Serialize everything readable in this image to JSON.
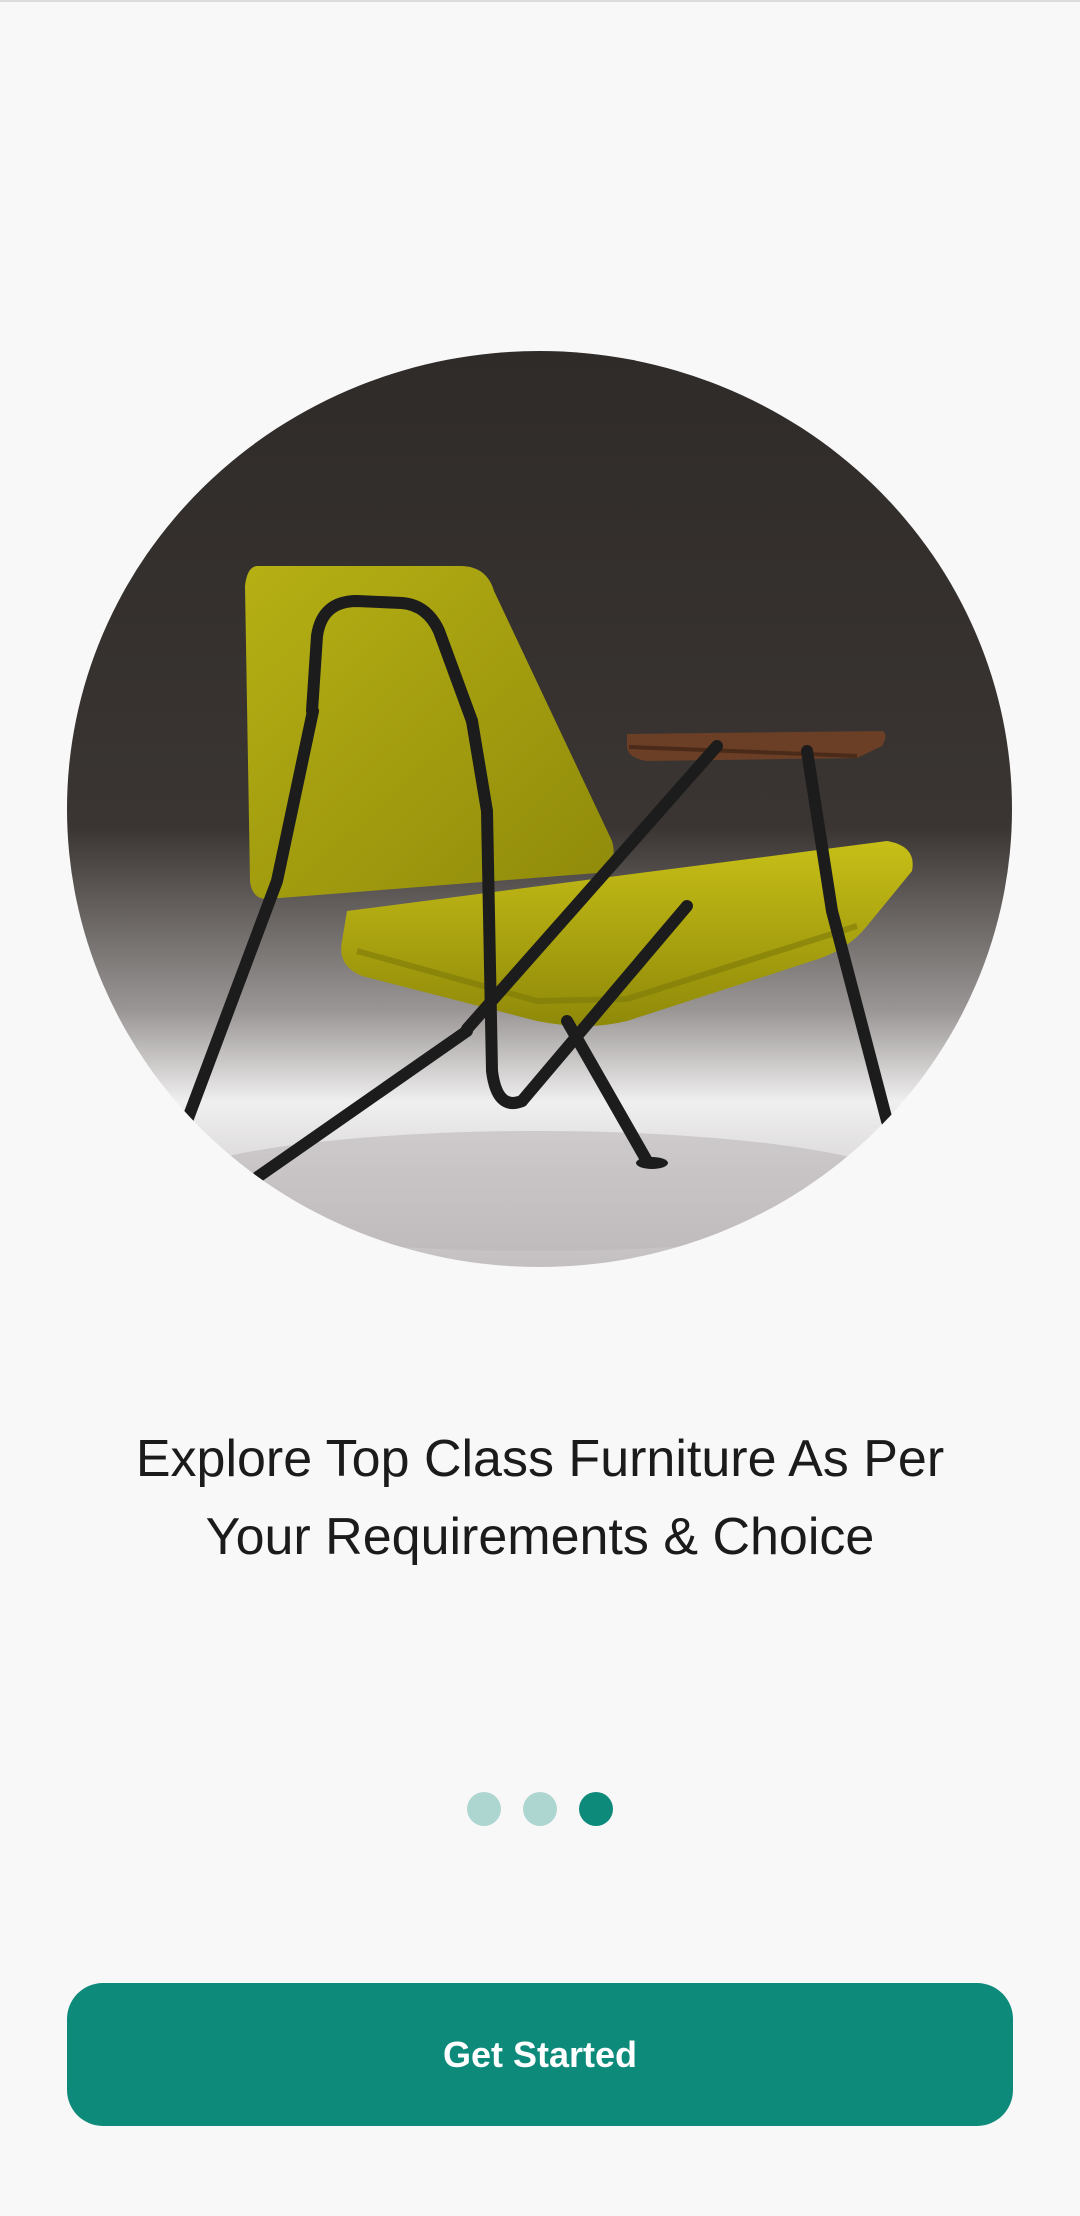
{
  "onboarding": {
    "headline_line1": "Explore Top Class Furniture As Per",
    "headline_line2": "Your Requirements & Choice",
    "pager": {
      "total_pages": 3,
      "active_page": 3
    },
    "cta_label": "Get Started"
  },
  "colors": {
    "background": "#f8f8f8",
    "accent": "#0e8a7b",
    "dot_inactive": "#aed6d1",
    "text": "#1b1b1b"
  }
}
